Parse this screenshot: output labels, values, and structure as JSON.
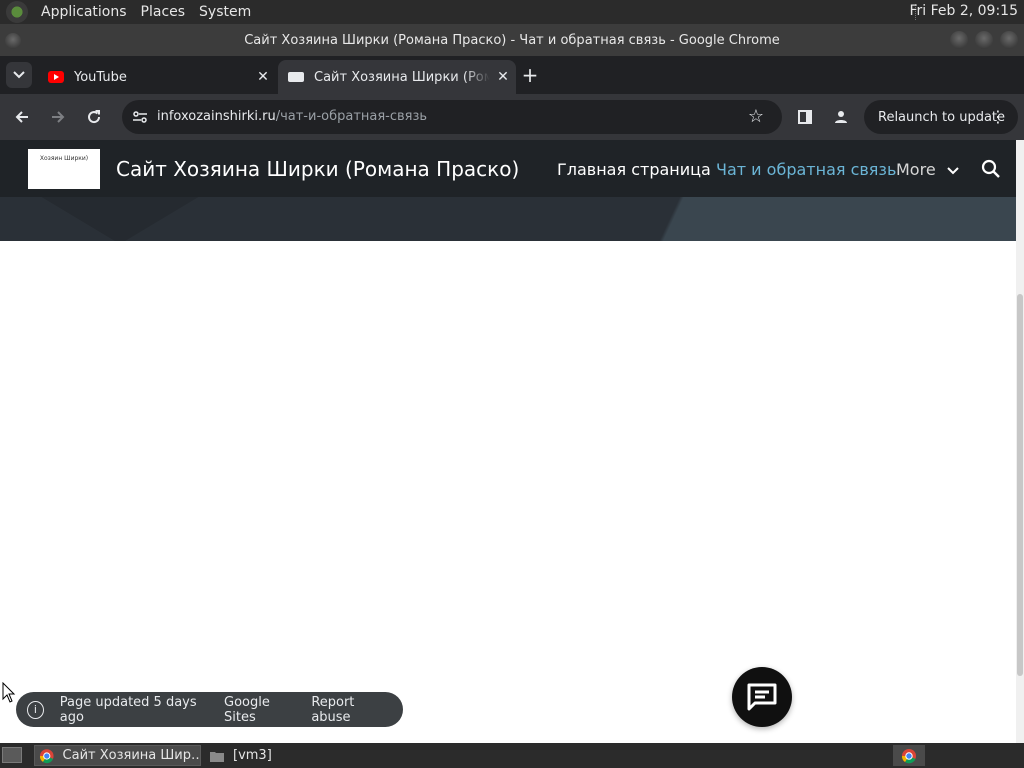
{
  "top_panel": {
    "menus": [
      "Applications",
      "Places",
      "System"
    ],
    "clock": "Fri Feb  2, 09:15"
  },
  "window": {
    "title": "Сайт Хозяина Ширки (Романа Праско) - Чат и обратная связь - Google Chrome"
  },
  "tabs": [
    {
      "title": "YouTube",
      "favicon": "youtube-icon",
      "close": "✕"
    },
    {
      "title": "Сайт Хозяина Ширки (Романа Праско)",
      "favicon": "page-icon",
      "close": "✕"
    }
  ],
  "toolbar": {
    "url_host": "infoxozainshirki.ru",
    "url_path": "/чат-и-обратная-связь",
    "relaunch_label": "Relaunch to update"
  },
  "site": {
    "logo_text": "Хозяин Ширки)",
    "title": "Сайт Хозяина Ширки (Романа Праско)",
    "nav": [
      {
        "label": "Главная страница",
        "active": false
      },
      {
        "label": "Чат и обратная связь",
        "active": true
      },
      {
        "label": "More",
        "active": false
      }
    ],
    "accent_color": "#6bb5d6"
  },
  "footer": {
    "updated": "Page updated 5 days ago",
    "google_sites": "Google Sites",
    "report_abuse": "Report abuse"
  },
  "taskbar": {
    "items": [
      {
        "label": "Сайт Хозяина Шир…",
        "icon": "chrome-icon"
      },
      {
        "label": "[vm3]",
        "icon": "folder-icon"
      }
    ]
  }
}
